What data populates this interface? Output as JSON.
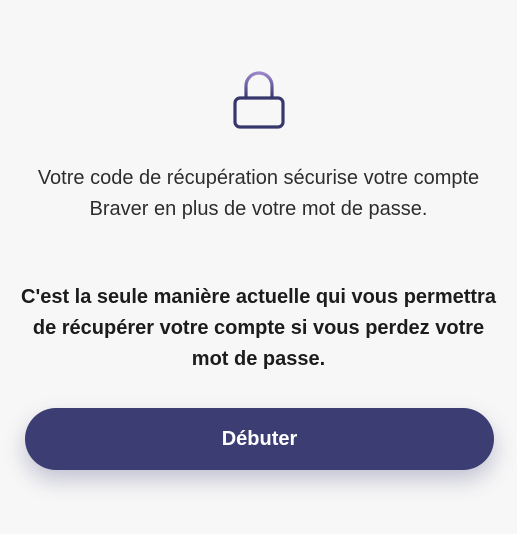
{
  "icons": {
    "lock": "lock-icon"
  },
  "colors": {
    "lock_body": "#36376b",
    "lock_shackle": "#9b86c7",
    "button_bg": "#3b3d73",
    "button_text": "#ffffff"
  },
  "recovery": {
    "intro_text": "Votre code de récupération sécurise votre compte Braver en plus de votre mot de passe.",
    "warning_text": "C'est la seule manière actuelle qui vous permettra de récupérer votre compte si vous perdez votre mot de passe.",
    "start_label": "Débuter"
  }
}
